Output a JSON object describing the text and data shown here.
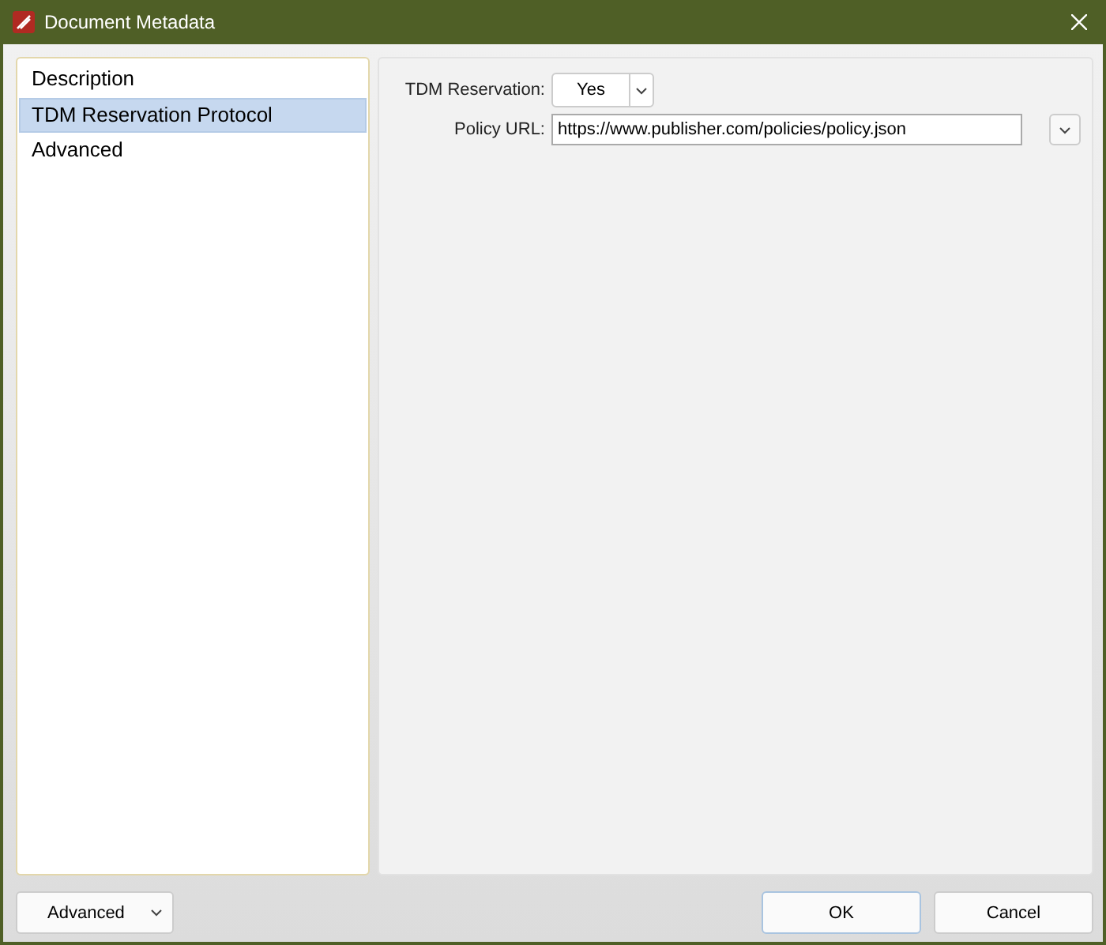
{
  "window": {
    "title": "Document Metadata"
  },
  "sidebar": {
    "items": [
      {
        "label": "Description",
        "selected": false
      },
      {
        "label": "TDM Reservation Protocol",
        "selected": true
      },
      {
        "label": "Advanced",
        "selected": false
      }
    ]
  },
  "form": {
    "reservation": {
      "label": "TDM Reservation:",
      "value": "Yes"
    },
    "policy_url": {
      "label": "Policy URL:",
      "value": "https://www.publisher.com/policies/policy.json"
    }
  },
  "footer": {
    "menu_button": "Advanced",
    "buttons": [
      {
        "label": "OK",
        "default": true
      },
      {
        "label": "Cancel",
        "default": false
      }
    ]
  }
}
